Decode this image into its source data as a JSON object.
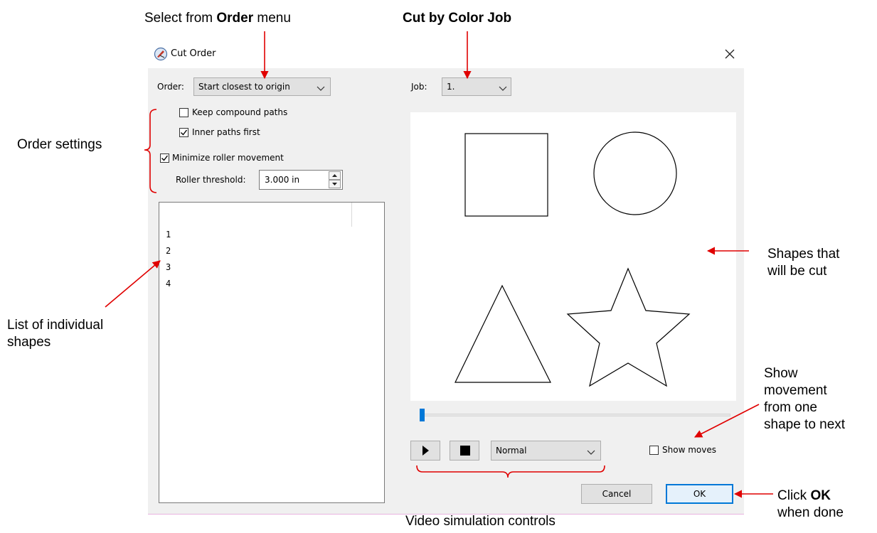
{
  "annotations": {
    "order_menu_prefix": "Select from ",
    "order_menu_bold": "Order",
    "order_menu_suffix": " menu",
    "cut_by_color": "Cut by Color Job",
    "order_settings": "Order settings",
    "list_of_shapes_1": "List of individual",
    "list_of_shapes_2": "shapes",
    "shapes_cut_1": "Shapes that",
    "shapes_cut_2": "will be cut",
    "show_movement_1": "Show",
    "show_movement_2": "movement",
    "show_movement_3": "from one",
    "show_movement_4": "shape to next",
    "click_ok_prefix": "Click ",
    "click_ok_bold": "OK",
    "click_ok_2": "when done",
    "video_controls": "Video simulation controls"
  },
  "dialog": {
    "title": "Cut Order",
    "order_label": "Order:",
    "order_value": "Start closest to origin",
    "job_label": "Job:",
    "job_value": "1.",
    "keep_compound_label": "Keep compound paths",
    "keep_compound_checked": false,
    "inner_paths_label": "Inner paths first",
    "inner_paths_checked": true,
    "minimize_roller_label": "Minimize roller movement",
    "minimize_roller_checked": true,
    "roller_threshold_label": "Roller threshold:",
    "roller_threshold_value": "3.000 in",
    "shape_list": [
      "1",
      "2",
      "3",
      "4"
    ],
    "speed_value": "Normal",
    "show_moves_label": "Show moves",
    "show_moves_checked": false,
    "cancel_label": "Cancel",
    "ok_label": "OK",
    "progress": 0.0
  },
  "colors": {
    "arrow": "#e00000",
    "bracket": "#e00000",
    "accent": "#0078d7"
  }
}
